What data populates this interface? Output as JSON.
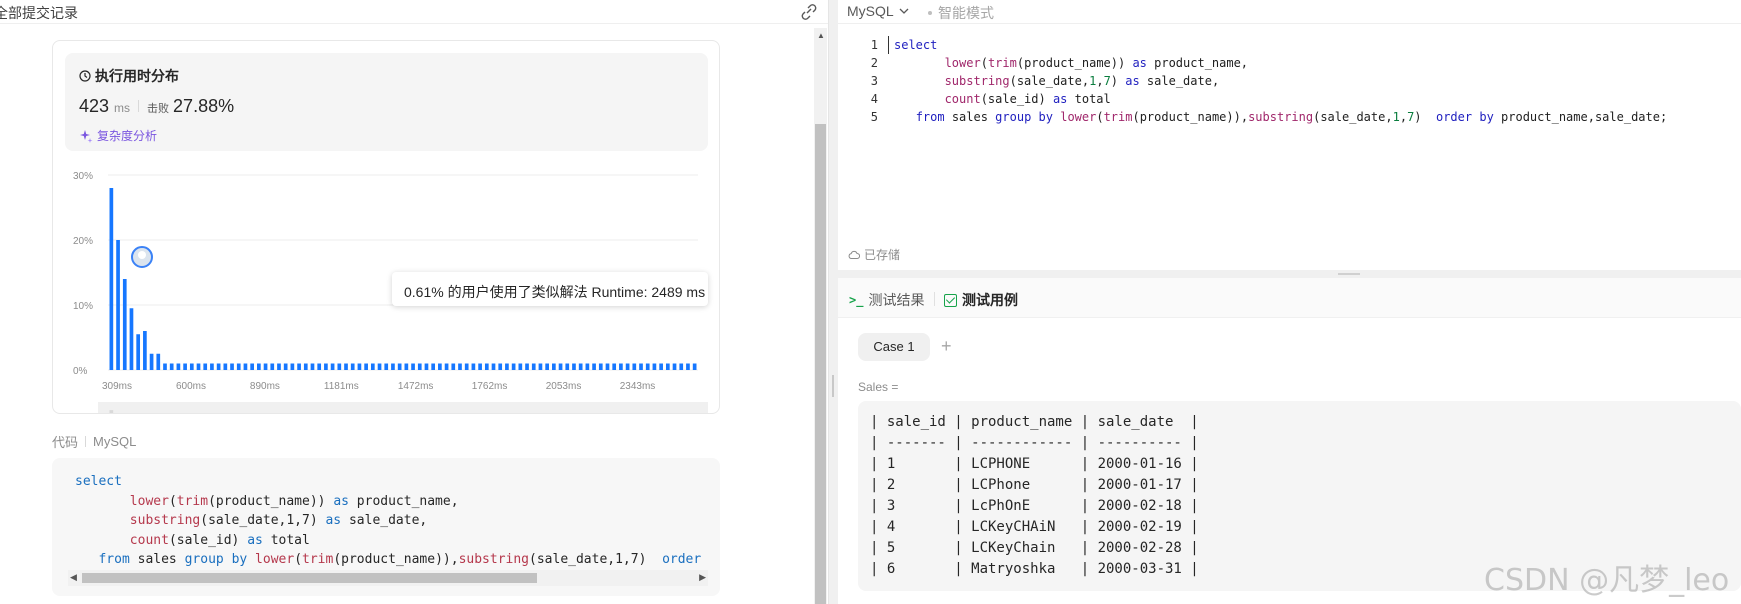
{
  "left": {
    "title": "全部提交记录",
    "runtime": {
      "title": "执行用时分布",
      "value": "423",
      "unit": "ms",
      "beat_label": "击败",
      "beat_value": "27.88%",
      "complexity_link": "复杂度分析",
      "tooltip": "0.61% 的用户使用了类似解法 Runtime: 2489 ms"
    },
    "code_label": "代码",
    "code_lang": "MySQL",
    "code_lines": [
      "select",
      "       lower(trim(product_name)) as product_name,",
      "       substring(sale_date,1,7) as sale_date,",
      "       count(sale_id) as total",
      "   from sales group by lower(trim(product_name)),substring(sale_date,1,7)  order"
    ]
  },
  "chart_data": {
    "type": "bar",
    "ylabel_ticks": [
      "30%",
      "20%",
      "10%",
      "0%"
    ],
    "ylim": [
      0,
      30
    ],
    "x_tick_labels": [
      "309ms",
      "600ms",
      "890ms",
      "1181ms",
      "1472ms",
      "1762ms",
      "2053ms",
      "2343ms"
    ],
    "values": [
      28,
      20,
      14,
      9.5,
      5.5,
      6,
      2.5,
      2.5,
      1,
      1,
      1,
      1,
      1,
      1,
      1,
      1,
      1,
      1,
      1,
      1,
      1,
      1,
      1,
      1,
      1,
      1,
      1,
      1,
      1,
      1,
      1,
      1,
      1,
      1,
      1,
      1,
      1,
      1,
      1,
      1,
      1,
      1,
      1,
      1,
      1,
      1,
      1,
      1,
      1,
      1,
      1,
      1,
      1,
      1,
      1,
      1,
      1,
      1,
      1,
      1,
      1,
      1,
      1,
      1,
      1,
      1,
      1,
      1,
      1,
      1,
      1,
      1,
      1,
      1,
      1,
      1,
      1,
      1,
      1,
      1,
      1,
      1,
      1,
      1,
      1,
      1,
      1,
      1
    ],
    "grid": true,
    "bar_color": "#1677ff"
  },
  "right": {
    "language": "MySQL",
    "smart_mode": "智能模式",
    "line_numbers": [
      "1",
      "2",
      "3",
      "4",
      "5"
    ],
    "saved_label": "已存储",
    "tab_result": "测试结果",
    "tab_cases": "测试用例",
    "case_label": "Case 1",
    "add_case": "+",
    "sales_label": "Sales =",
    "sales_table": [
      "| sale_id | product_name | sale_date  |",
      "| ------- | ------------ | ---------- |",
      "| 1       | LCPHONE      | 2000-01-16 |",
      "| 2       | LCPhone      | 2000-01-17 |",
      "| 3       | LcPhOnE      | 2000-02-18 |",
      "| 4       | LCKeyCHAiN   | 2000-02-19 |",
      "| 5       | LCKeyChain   | 2000-02-28 |",
      "| 6       | Matryoshka   | 2000-03-31 |"
    ]
  },
  "watermark": "CSDN @凡梦_leo"
}
